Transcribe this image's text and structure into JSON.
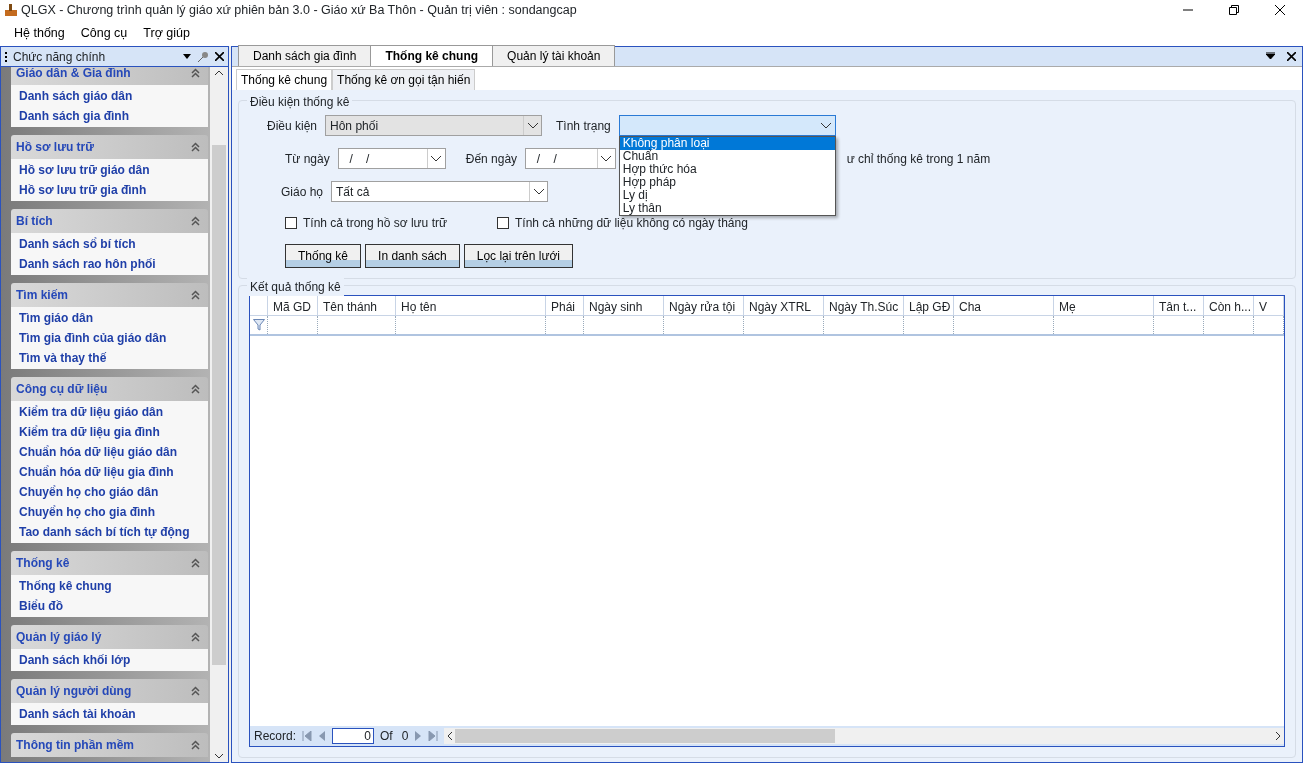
{
  "window": {
    "title": "QLGX - Chương trình quản lý giáo xứ phiên bản 3.0 - Giáo xứ Ba Thôn - Quản trị viên : sondangcap"
  },
  "menu": [
    "Hệ thống",
    "Công cụ",
    "Trợ giúp"
  ],
  "sidebar": {
    "title": "Chức năng chính",
    "groups": [
      {
        "title": "Giáo dân & Gia đình",
        "items": [
          "Danh sách giáo dân",
          "Danh sách gia đình"
        ]
      },
      {
        "title": "Hồ sơ lưu trữ",
        "items": [
          "Hồ sơ lưu trữ giáo dân",
          "Hồ sơ lưu trữ gia đình"
        ]
      },
      {
        "title": "Bí tích",
        "items": [
          "Danh sách sổ bí tích",
          "Danh sách rao hôn phối"
        ]
      },
      {
        "title": "Tìm kiếm",
        "items": [
          "Tìm giáo dân",
          "Tìm gia đình của giáo dân",
          "Tìm và thay thế"
        ]
      },
      {
        "title": "Công cụ dữ liệu",
        "items": [
          "Kiểm tra dữ liệu giáo dân",
          "Kiểm tra dữ liệu gia đình",
          "Chuẩn hóa dữ liệu giáo dân",
          "Chuẩn hóa dữ liệu gia đình",
          "Chuyển họ cho giáo dân",
          "Chuyển họ cho gia đình",
          "Tao danh sách bí tích tự động"
        ]
      },
      {
        "title": "Thống kê",
        "items": [
          "Thống kê chung",
          "Biểu đồ"
        ]
      },
      {
        "title": "Quản lý giáo lý",
        "items": [
          "Danh sách khối lớp"
        ]
      },
      {
        "title": "Quản lý người dùng",
        "items": [
          "Danh sách tài khoản"
        ]
      },
      {
        "title": "Thông tin phần mềm"
      }
    ]
  },
  "doc_tabs": [
    {
      "label": "Danh sách gia đình",
      "selected": false
    },
    {
      "label": "Thống kê chung",
      "selected": true
    },
    {
      "label": "Quản lý tài khoản",
      "selected": false
    }
  ],
  "sub_tabs": [
    {
      "label": "Thống kê chung",
      "selected": true
    },
    {
      "label": "Thống kê ơn gọi tận hiến",
      "selected": false
    }
  ],
  "conditions": {
    "title": "Điều kiện thống kê",
    "condition": {
      "label": "Điều kiện",
      "value": "Hôn phối"
    },
    "status": {
      "label": "Tình trạng",
      "options": [
        {
          "label": "Không phân loại",
          "selected": true
        },
        {
          "label": "Chuẩn",
          "selected": false
        },
        {
          "label": "Hợp thức hóa",
          "selected": false
        },
        {
          "label": "Hợp pháp",
          "selected": false
        },
        {
          "label": "Ly dị",
          "selected": false
        },
        {
          "label": "Ly thân",
          "selected": false
        }
      ]
    },
    "from_date": {
      "label": "Từ ngày",
      "value": "  /    /"
    },
    "to_date": {
      "label": "Đến ngày",
      "value": "  /    /"
    },
    "note": "ư chỉ thống kê trong 1 năm",
    "parish": {
      "label": "Giáo họ",
      "value": "Tất cả"
    },
    "checkboxes": [
      {
        "label": "Tính cả trong hồ sơ lưu trữ",
        "checked": false
      },
      {
        "label": "Tính cả những dữ liệu không có ngày tháng",
        "checked": false
      }
    ],
    "buttons": [
      "Thống kê",
      "In danh sách",
      "Lọc lại trên lưới"
    ]
  },
  "results": {
    "title": "Kết quả thống kê",
    "columns": [
      "Mã GD",
      "Tên thánh",
      "Họ tên",
      "Phái",
      "Ngày sinh",
      "Ngày rửa tội",
      "Ngày XTRL",
      "Ngày Th.Súc",
      "Lập GĐ",
      "Cha",
      "Mẹ",
      "Tân t...",
      "Còn h...",
      "V"
    ],
    "pager": {
      "label": "Record:",
      "current": "0",
      "of": "Of",
      "total": "0"
    }
  }
}
